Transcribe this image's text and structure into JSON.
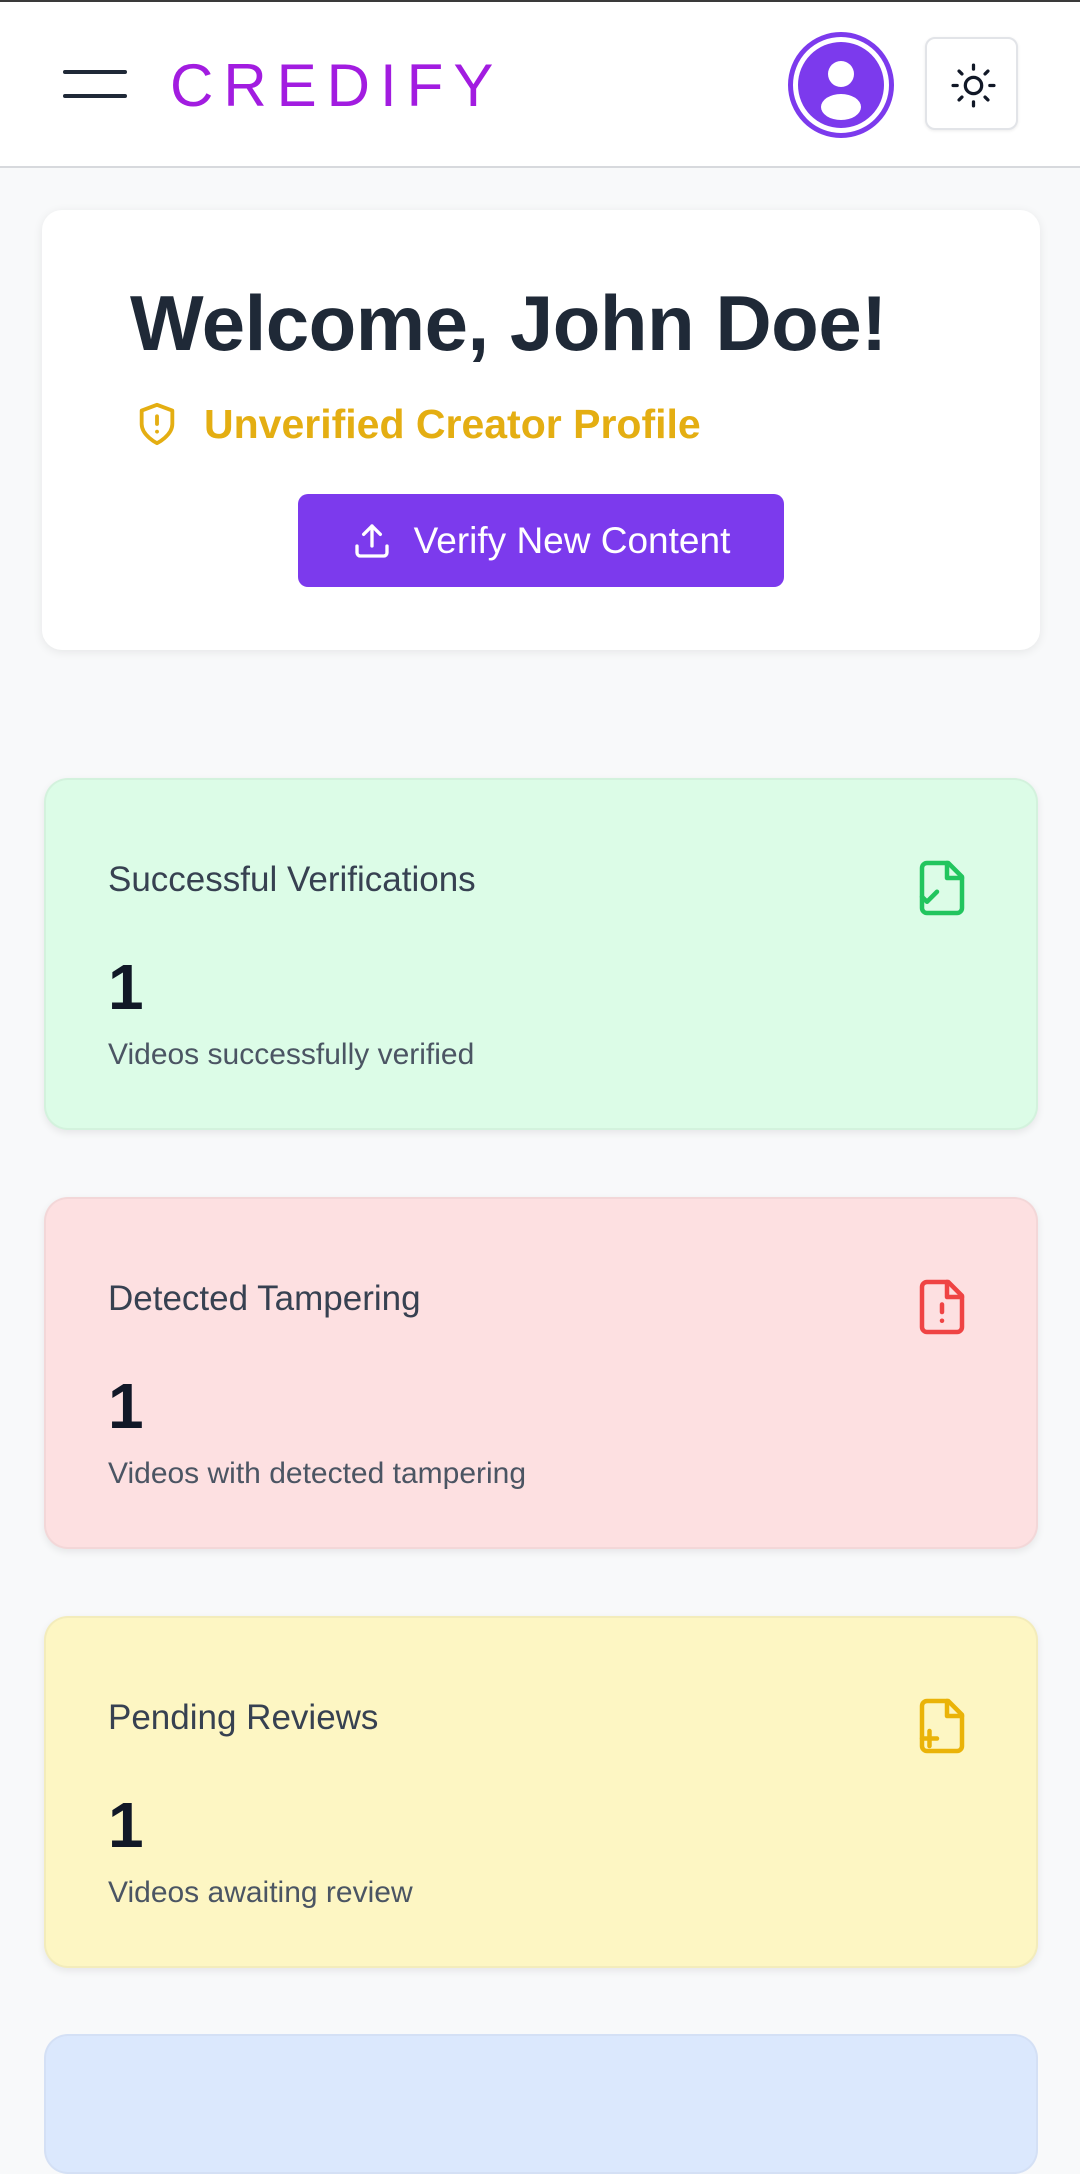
{
  "header": {
    "logo_text": "CREDIFY",
    "menu_icon": "hamburger-menu-icon",
    "avatar_icon": "user-avatar-icon",
    "theme_icon": "sun-icon",
    "brand_color": "#a21ce0"
  },
  "welcome": {
    "title": "Welcome, John Doe!",
    "profile_status": "Unverified Creator Profile",
    "status_icon": "shield-alert-icon",
    "verify_button_label": "Verify New Content",
    "verify_button_icon": "upload-icon",
    "accent_color": "#7c3aed",
    "warning_color": "#e4ae12"
  },
  "stats": [
    {
      "title": "Successful Verifications",
      "value": "1",
      "description": "Videos successfully verified",
      "icon": "file-check-icon",
      "color": "#22c55e",
      "background": "#dcfce7"
    },
    {
      "title": "Detected Tampering",
      "value": "1",
      "description": "Videos with detected tampering",
      "icon": "file-alert-icon",
      "color": "#ef4444",
      "background": "#fde0e1"
    },
    {
      "title": "Pending Reviews",
      "value": "1",
      "description": "Videos awaiting review",
      "icon": "file-plus-icon",
      "color": "#eab308",
      "background": "#fdf6c3"
    }
  ]
}
